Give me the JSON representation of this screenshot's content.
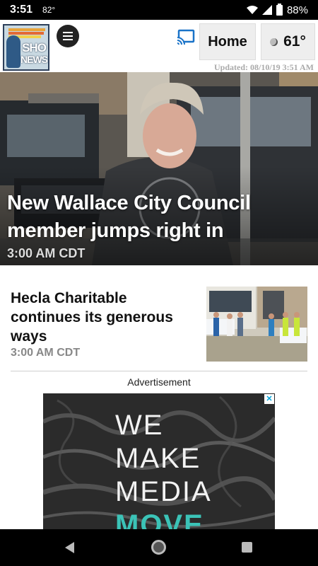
{
  "status": {
    "time": "3:51",
    "temp": "82°",
    "battery": "88%"
  },
  "header": {
    "logo_line1": "SHO",
    "logo_line2": "NEWS",
    "home_label": "Home",
    "weather_temp": "61°",
    "updated": "Updated: 08/10/19 3:51 AM"
  },
  "hero": {
    "title": "New Wallace City Council member jumps right in",
    "time": "3:00 AM CDT"
  },
  "story": {
    "title": "Hecla Charitable continues its generous ways",
    "time": "3:00 AM CDT"
  },
  "ad": {
    "label": "Advertisement",
    "lines": [
      "WE",
      "MAKE",
      "MEDIA",
      "MOVE"
    ]
  },
  "colors": {
    "ad_accent": "#3bc3b7",
    "cast_icon": "#1a73c8",
    "logo_border": "#2d3f5a"
  },
  "icons": {
    "menu": "hamburger-icon",
    "cast": "cast-icon",
    "weather": "moon-icon",
    "adchoices": "adchoices-icon"
  }
}
